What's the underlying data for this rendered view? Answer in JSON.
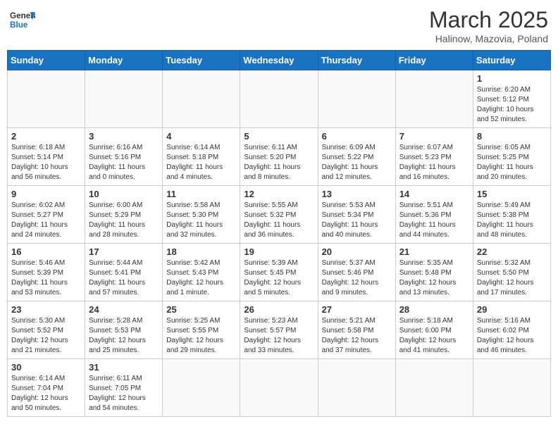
{
  "logo": {
    "general": "General",
    "blue": "Blue"
  },
  "title": "March 2025",
  "subtitle": "Halinow, Mazovia, Poland",
  "days_of_week": [
    "Sunday",
    "Monday",
    "Tuesday",
    "Wednesday",
    "Thursday",
    "Friday",
    "Saturday"
  ],
  "weeks": [
    [
      {
        "day": "",
        "info": ""
      },
      {
        "day": "",
        "info": ""
      },
      {
        "day": "",
        "info": ""
      },
      {
        "day": "",
        "info": ""
      },
      {
        "day": "",
        "info": ""
      },
      {
        "day": "",
        "info": ""
      },
      {
        "day": "1",
        "info": "Sunrise: 6:20 AM\nSunset: 5:12 PM\nDaylight: 10 hours and 52 minutes."
      }
    ],
    [
      {
        "day": "2",
        "info": "Sunrise: 6:18 AM\nSunset: 5:14 PM\nDaylight: 10 hours and 56 minutes."
      },
      {
        "day": "3",
        "info": "Sunrise: 6:16 AM\nSunset: 5:16 PM\nDaylight: 11 hours and 0 minutes."
      },
      {
        "day": "4",
        "info": "Sunrise: 6:14 AM\nSunset: 5:18 PM\nDaylight: 11 hours and 4 minutes."
      },
      {
        "day": "5",
        "info": "Sunrise: 6:11 AM\nSunset: 5:20 PM\nDaylight: 11 hours and 8 minutes."
      },
      {
        "day": "6",
        "info": "Sunrise: 6:09 AM\nSunset: 5:22 PM\nDaylight: 11 hours and 12 minutes."
      },
      {
        "day": "7",
        "info": "Sunrise: 6:07 AM\nSunset: 5:23 PM\nDaylight: 11 hours and 16 minutes."
      },
      {
        "day": "8",
        "info": "Sunrise: 6:05 AM\nSunset: 5:25 PM\nDaylight: 11 hours and 20 minutes."
      }
    ],
    [
      {
        "day": "9",
        "info": "Sunrise: 6:02 AM\nSunset: 5:27 PM\nDaylight: 11 hours and 24 minutes."
      },
      {
        "day": "10",
        "info": "Sunrise: 6:00 AM\nSunset: 5:29 PM\nDaylight: 11 hours and 28 minutes."
      },
      {
        "day": "11",
        "info": "Sunrise: 5:58 AM\nSunset: 5:30 PM\nDaylight: 11 hours and 32 minutes."
      },
      {
        "day": "12",
        "info": "Sunrise: 5:55 AM\nSunset: 5:32 PM\nDaylight: 11 hours and 36 minutes."
      },
      {
        "day": "13",
        "info": "Sunrise: 5:53 AM\nSunset: 5:34 PM\nDaylight: 11 hours and 40 minutes."
      },
      {
        "day": "14",
        "info": "Sunrise: 5:51 AM\nSunset: 5:36 PM\nDaylight: 11 hours and 44 minutes."
      },
      {
        "day": "15",
        "info": "Sunrise: 5:49 AM\nSunset: 5:38 PM\nDaylight: 11 hours and 48 minutes."
      }
    ],
    [
      {
        "day": "16",
        "info": "Sunrise: 5:46 AM\nSunset: 5:39 PM\nDaylight: 11 hours and 53 minutes."
      },
      {
        "day": "17",
        "info": "Sunrise: 5:44 AM\nSunset: 5:41 PM\nDaylight: 11 hours and 57 minutes."
      },
      {
        "day": "18",
        "info": "Sunrise: 5:42 AM\nSunset: 5:43 PM\nDaylight: 12 hours and 1 minute."
      },
      {
        "day": "19",
        "info": "Sunrise: 5:39 AM\nSunset: 5:45 PM\nDaylight: 12 hours and 5 minutes."
      },
      {
        "day": "20",
        "info": "Sunrise: 5:37 AM\nSunset: 5:46 PM\nDaylight: 12 hours and 9 minutes."
      },
      {
        "day": "21",
        "info": "Sunrise: 5:35 AM\nSunset: 5:48 PM\nDaylight: 12 hours and 13 minutes."
      },
      {
        "day": "22",
        "info": "Sunrise: 5:32 AM\nSunset: 5:50 PM\nDaylight: 12 hours and 17 minutes."
      }
    ],
    [
      {
        "day": "23",
        "info": "Sunrise: 5:30 AM\nSunset: 5:52 PM\nDaylight: 12 hours and 21 minutes."
      },
      {
        "day": "24",
        "info": "Sunrise: 5:28 AM\nSunset: 5:53 PM\nDaylight: 12 hours and 25 minutes."
      },
      {
        "day": "25",
        "info": "Sunrise: 5:25 AM\nSunset: 5:55 PM\nDaylight: 12 hours and 29 minutes."
      },
      {
        "day": "26",
        "info": "Sunrise: 5:23 AM\nSunset: 5:57 PM\nDaylight: 12 hours and 33 minutes."
      },
      {
        "day": "27",
        "info": "Sunrise: 5:21 AM\nSunset: 5:58 PM\nDaylight: 12 hours and 37 minutes."
      },
      {
        "day": "28",
        "info": "Sunrise: 5:18 AM\nSunset: 6:00 PM\nDaylight: 12 hours and 41 minutes."
      },
      {
        "day": "29",
        "info": "Sunrise: 5:16 AM\nSunset: 6:02 PM\nDaylight: 12 hours and 46 minutes."
      }
    ],
    [
      {
        "day": "30",
        "info": "Sunrise: 6:14 AM\nSunset: 7:04 PM\nDaylight: 12 hours and 50 minutes."
      },
      {
        "day": "31",
        "info": "Sunrise: 6:11 AM\nSunset: 7:05 PM\nDaylight: 12 hours and 54 minutes."
      },
      {
        "day": "",
        "info": ""
      },
      {
        "day": "",
        "info": ""
      },
      {
        "day": "",
        "info": ""
      },
      {
        "day": "",
        "info": ""
      },
      {
        "day": "",
        "info": ""
      }
    ]
  ]
}
